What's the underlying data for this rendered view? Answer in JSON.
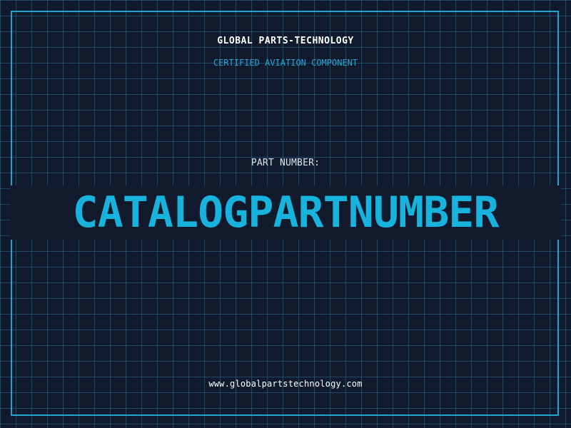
{
  "header": {
    "company": "GLOBAL PARTS-TECHNOLOGY",
    "subtitle": "CERTIFIED AVIATION COMPONENT"
  },
  "part": {
    "label": "PART NUMBER:",
    "value": "CATALOGPARTNUMBER"
  },
  "footer": {
    "website": "www.globalpartstechnology.com"
  },
  "colors": {
    "background": "#111a2c",
    "grid": "#246686",
    "frame": "#1fa6cf",
    "accent": "#18b3dc",
    "subtitle": "#24a7d8",
    "text": "#ffffff"
  }
}
